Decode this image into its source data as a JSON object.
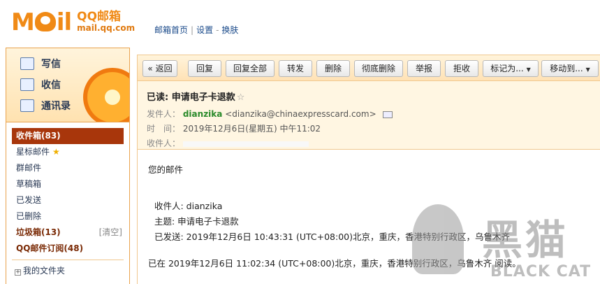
{
  "brand": {
    "logo_word": "Mail",
    "name_cn": "QQ邮箱",
    "domain": "mail.qq.com"
  },
  "topnav": {
    "home": "邮箱首页",
    "settings": "设置",
    "skin": "换肤",
    "sep1": "|",
    "sep2": "-"
  },
  "quick_actions": {
    "compose": "写信",
    "inbox": "收信",
    "contacts": "通讯录"
  },
  "folders": {
    "inbox": "收件箱(83)",
    "starred": "星标邮件",
    "group": "群邮件",
    "drafts": "草稿箱",
    "sent": "已发送",
    "deleted": "已删除",
    "spam": "垃圾箱(13)",
    "spam_clear": "[清空]",
    "subscriptions": "QQ邮件订阅(48)",
    "my_folders": "我的文件夹"
  },
  "toolbar": {
    "back": "« 返回",
    "reply": "回复",
    "reply_all": "回复全部",
    "forward": "转发",
    "delete": "删除",
    "delete_permanent": "彻底删除",
    "report": "举报",
    "reject": "拒收",
    "mark_as": "标记为...",
    "move_to": "移动到..."
  },
  "message": {
    "subject": "已读: 申请电子卡退款",
    "from_label": "发件人：",
    "from_name": "dianzika",
    "from_email": "<dianzika@chinaexpresscard.com>",
    "time_label": "时　间：",
    "time_value": "2019年12月6日(星期五) 中午11:02",
    "to_label": "收件人："
  },
  "body": {
    "line1": "您的邮件",
    "line2": "收件人: dianzika",
    "line3": "主题: 申请电子卡退款",
    "line4": "已发送: 2019年12月6日 10:43:31 (UTC+08:00)北京，重庆，香港特别行政区，乌鲁木齐",
    "line5": "已在 2019年12月6日 11:02:34 (UTC+08:00)北京，重庆，香港特别行政区，乌鲁木齐 阅读。"
  },
  "watermark": {
    "cn": "黑猫",
    "en": "BLACK CAT"
  },
  "colors": {
    "brand_orange": "#f08a16",
    "active_folder": "#a8360b",
    "sender_green": "#2a8a2a"
  },
  "icons": [
    "compose-icon",
    "inbox-icon",
    "contacts-icon",
    "star-icon",
    "card-icon",
    "chevron-down-icon"
  ]
}
